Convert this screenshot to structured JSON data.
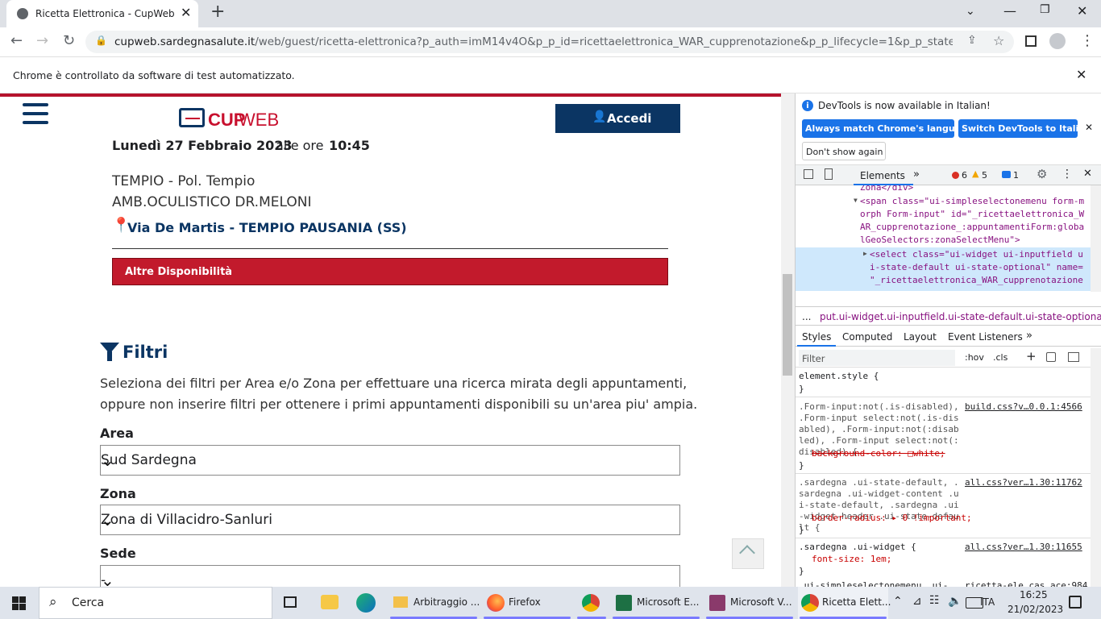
{
  "browser": {
    "tab_title": "Ricetta Elettronica - CupWeb",
    "new_tab": "+",
    "url_host": "cupweb.sardegnasalute.it",
    "url_path": "/web/guest/ricetta-elettronica?p_auth=imM14v4O&p_p_id=ricettaelettronica_WAR_cupprenotazione&p_p_lifecycle=1&p_p_state=normal&p_...",
    "infobar_text": "Chrome è controllato da software di test automatizzato."
  },
  "site": {
    "logo_cup": "CUP",
    "logo_web": "WEB",
    "login_label": "Accedi"
  },
  "appointment": {
    "date": "Lunedì 27 Febbraio 2023",
    "at_label": "alle ore",
    "time": "10:45",
    "location1": "TEMPIO - Pol. Tempio",
    "location2": "AMB.OCULISTICO DR.MELONI",
    "address": "Via De Martis - TEMPIO PAUSANIA (SS)",
    "more_button": "Altre Disponibilità"
  },
  "filters": {
    "title": "Filtri",
    "desc1": "Seleziona dei filtri per Area e/o Zona per effettuare una ricerca mirata degli appuntamenti,",
    "desc2": "oppure non inserire filtri per ottenere i primi appuntamenti disponibili su un'area piu' ampia.",
    "area_label": "Area",
    "area_value": "Sud Sardegna",
    "zona_label": "Zona",
    "zona_value": "Zona di Villacidro-Sanluri",
    "sede_label": "Sede",
    "sede_value": "-"
  },
  "devtools": {
    "notice": "DevTools is now available in Italian!",
    "btn_match": "Always match Chrome's language",
    "btn_switch": "Switch DevTools to Italian",
    "btn_dont": "Don't show again",
    "tab_elements": "Elements",
    "errors": "6",
    "warnings": "5",
    "messages": "1",
    "code": [
      "Zona</div>",
      "<span class=\"ui-simpleselectonemenu form-m",
      "orph Form-input\" id=\"_ricettaelettronica_W",
      "AR_cupprenotazione_:appuntamentiForm:globa",
      "lGeoSelectors:zonaSelectMenu\">",
      "<select class=\"ui-widget ui-inputfield u",
      "i-state-default ui-state-optional\" name=",
      "\"_ricettaelettronica_WAR_cupprenotazione"
    ],
    "breadcrumb_dots": "...",
    "breadcrumb": "put.ui-widget.ui-inputfield.ui-state-default.ui-state-optional",
    "panel_tabs": [
      "Styles",
      "Computed",
      "Layout",
      "Event Listeners"
    ],
    "filter_placeholder": "Filter",
    "hov": ":hov",
    "cls": ".cls",
    "rules": [
      {
        "selector": "element.style {",
        "source": "",
        "lines": [
          "}"
        ]
      },
      {
        "selector": ".Form-input:not(.is-disabled), .Form-input select:not(.is-disabled), .Form-input:not(:disabled), .Form-input select:not(:disabled) {",
        "source": "build.css?v…0.0.1:4566",
        "lines": [
          "background-color: □white;",
          "}"
        ]
      },
      {
        "selector": ".sardegna .ui-state-default, .sardegna .ui-widget-content .ui-state-default, .sardegna .ui-widget-header .ui-state-default {",
        "source": "all.css?ver…1.30:11762",
        "lines": [
          "border-radius: ▸ 0 !important;",
          "}"
        ]
      },
      {
        "selector": ".sardegna .ui-widget {",
        "source": "all.css?ver…1.30:11655",
        "lines": [
          "font-size: 1em;",
          "}"
        ]
      },
      {
        "selector": ".ui-simpleselectonemenu .ui-",
        "source": "ricetta-ele cas ace:984",
        "lines": []
      }
    ]
  },
  "taskbar": {
    "search": "Cerca",
    "apps": [
      {
        "label": "Arbitraggio ..."
      },
      {
        "label": "Firefox"
      },
      {
        "label": ""
      },
      {
        "label": "Microsoft E..."
      },
      {
        "label": "Microsoft V..."
      },
      {
        "label": "Ricetta Elett..."
      }
    ],
    "lang": "ITA",
    "time": "16:25",
    "date": "21/02/2023"
  },
  "colors": {
    "navy": "#003a6c",
    "red": "#c8102e",
    "blue_btn": "#1a73e8"
  }
}
